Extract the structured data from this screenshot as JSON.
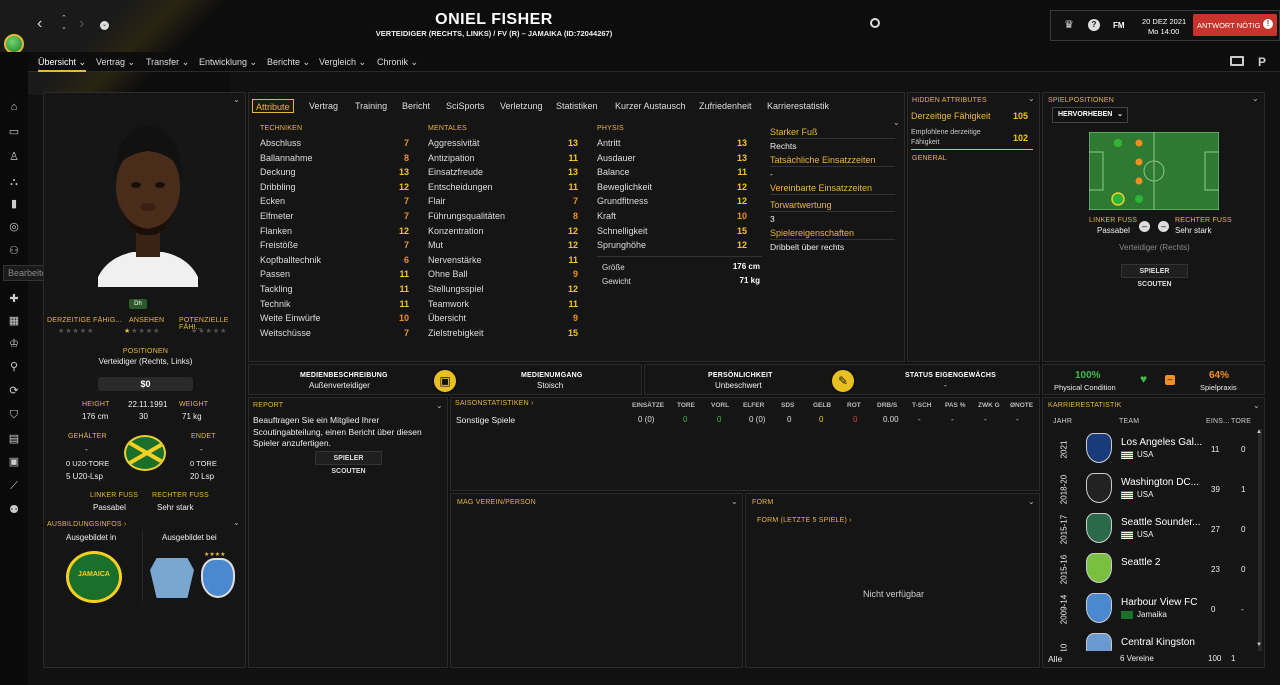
{
  "header": {
    "player_name": "ONIEL FISHER",
    "subtitle": "VERTEIDIGER (RECHTS, LINKS) / FV (R) – JAMAIKA (ID:72044267)",
    "date": "20 DEZ 2021",
    "time": "Mo 14:00",
    "fm": "FM",
    "answer_btn": "ANTWORT NÖTIG",
    "answer_icon": "exclamation-icon"
  },
  "nav": {
    "items": [
      "Übersicht",
      "Vertrag",
      "Transfer",
      "Entwicklung",
      "Berichte",
      "Vergleich",
      "Chronik"
    ]
  },
  "sidebar": {
    "tooltip": "Bearbeiten"
  },
  "profile": {
    "club_badge": "Dh",
    "labels": {
      "current": "DERZEITIGE FÄHIG...",
      "reputation": "ANSEHEN",
      "potential": "POTENZIELLE FÄHI..."
    },
    "positions_label": "POSITIONEN",
    "positions": "Verteidiger (Rechts, Links)",
    "value": "$0",
    "height_label": "HEIGHT",
    "dob": "22.11.1991",
    "weight_label": "WEIGHT",
    "height": "176 cm",
    "age": "30",
    "weight": "71 kg",
    "gehaelter_label": "GEHÄLTER",
    "gehaelter": "-",
    "endet_label": "ENDET",
    "endet": "-",
    "u20_label": "0 U20-TORE",
    "u20_lsp": "5 U20-Lsp",
    "tore": "0 TORE",
    "lsp": "20 Lsp",
    "left_foot_label": "LINKER FUSS",
    "left_foot": "Passabel",
    "right_foot_label": "RECHTER FUSS",
    "right_foot": "Sehr stark",
    "training_label": "AUSBILDUNGSINFOS",
    "trained_in": "Ausgebildet in",
    "trained_at": "Ausgebildet bei",
    "jamaica_text": "JAMAICA"
  },
  "tabs": [
    "Attribute",
    "Vertrag",
    "Training",
    "Bericht",
    "SciSports",
    "Verletzung",
    "Statistiken",
    "Kurzer Austausch",
    "Zufriedenheit",
    "Karrierestatistik"
  ],
  "attributes": {
    "tech_title": "TECHNIKEN",
    "technical": [
      [
        "Abschluss",
        "7"
      ],
      [
        "Ballannahme",
        "8"
      ],
      [
        "Deckung",
        "13"
      ],
      [
        "Dribbling",
        "12"
      ],
      [
        "Ecken",
        "7"
      ],
      [
        "Elfmeter",
        "7"
      ],
      [
        "Flanken",
        "12"
      ],
      [
        "Freistöße",
        "7"
      ],
      [
        "Kopfballtechnik",
        "6"
      ],
      [
        "Passen",
        "11"
      ],
      [
        "Tackling",
        "11"
      ],
      [
        "Technik",
        "11"
      ],
      [
        "Weite Einwürfe",
        "10"
      ],
      [
        "Weitschüsse",
        "7"
      ]
    ],
    "mental_title": "MENTALES",
    "mental": [
      [
        "Aggressivität",
        "13"
      ],
      [
        "Antizipation",
        "11"
      ],
      [
        "Einsatzfreude",
        "13"
      ],
      [
        "Entscheidungen",
        "11"
      ],
      [
        "Flair",
        "7"
      ],
      [
        "Führungsqualitäten",
        "8"
      ],
      [
        "Konzentration",
        "12"
      ],
      [
        "Mut",
        "12"
      ],
      [
        "Nervenstärke",
        "11"
      ],
      [
        "Ohne Ball",
        "9"
      ],
      [
        "Stellungsspiel",
        "12"
      ],
      [
        "Teamwork",
        "11"
      ],
      [
        "Übersicht",
        "9"
      ],
      [
        "Zielstrebigkeit",
        "15"
      ]
    ],
    "phys_title": "PHYSIS",
    "physical": [
      [
        "Antritt",
        "13"
      ],
      [
        "Ausdauer",
        "13"
      ],
      [
        "Balance",
        "11"
      ],
      [
        "Beweglichkeit",
        "12"
      ],
      [
        "Grundfitness",
        "12"
      ],
      [
        "Kraft",
        "10"
      ],
      [
        "Schnelligkeit",
        "15"
      ],
      [
        "Sprunghöhe",
        "12"
      ]
    ],
    "size": [
      [
        "Größe",
        "176 cm"
      ],
      [
        "Gewicht",
        "71 kg"
      ]
    ],
    "info": [
      [
        "Starker Fuß",
        "Rechts"
      ],
      [
        "Tatsächliche Einsatzzeiten",
        "-"
      ],
      [
        "Vereinbarte Einsatzzeiten",
        ""
      ],
      [
        "Torwartwertung",
        "3"
      ],
      [
        "Spielereigenschaften",
        "Dribbelt über rechts"
      ]
    ]
  },
  "hidden": {
    "title": "HIDDEN ATTRIBUTES",
    "current_label": "Derzeitige Fähigkeit",
    "current": "105",
    "recommended_label": "Empfohlene derzeitige Fähigkeit",
    "recommended": "102",
    "general": "GENERAL"
  },
  "positions_panel": {
    "title": "SPIELPOSITIONEN",
    "dropdown": "HERVORHEBEN",
    "left_foot_label": "LINKER FUSS",
    "left_foot": "Passabel",
    "right_foot_label": "RECHTER FUSS",
    "right_foot": "Sehr stark",
    "role": "Verteidiger (Rechts)",
    "scout_btn": "SPIELER SCOUTEN"
  },
  "media": {
    "desc_label": "MEDIENBESCHREIBUNG",
    "desc": "Außenverteidiger",
    "handling_label": "MEDIENUMGANG",
    "handling": "Stoisch",
    "personality_label": "PERSÖNLICHKEIT",
    "personality": "Unbeschwert",
    "homegrown_label": "STATUS EIGENGEWÄCHS",
    "homegrown": "-"
  },
  "condition": {
    "physical": "100%",
    "physical_label": "Physical Condition",
    "practice": "64%",
    "practice_label": "Spielpraxis"
  },
  "report": {
    "title": "REPORT",
    "text": "Beauftragen Sie ein Mitglied Ihrer Scoutingabteilung, einen Bericht über diesen Spieler anzufertigen.",
    "btn": "SPIELER SCOUTEN"
  },
  "season": {
    "title": "SAISONSTATISTIKEN",
    "headers": [
      "EINSÄTZE",
      "TORE",
      "VORL",
      "ELFER",
      "SDS",
      "GELB",
      "ROT",
      "DRB/S",
      "T-SCH",
      "PAS %",
      "ZWK G",
      "ØNOTE"
    ],
    "row_label": "Sonstige Spiele",
    "row": [
      "0 (0)",
      "0",
      "0",
      "0 (0)",
      "0",
      "0",
      "0",
      "0.00",
      "-",
      "-",
      "-",
      "-"
    ]
  },
  "fav_club": {
    "title": "MAG VEREIN/PERSON"
  },
  "form": {
    "title": "FORM",
    "subtitle": "FORM (LETZTE 5 SPIELE)",
    "empty": "Nicht verfügbar"
  },
  "career": {
    "title": "KARRIERESTATISTIK",
    "headers": [
      "JAHR",
      "TEAM",
      "EINS...",
      "TORE"
    ],
    "rows": [
      {
        "year": "2021",
        "team": "Los Angeles Gal...",
        "nation": "USA",
        "apps": "11",
        "goals": "0"
      },
      {
        "year": "2018-20",
        "team": "Washington DC...",
        "nation": "USA",
        "apps": "39",
        "goals": "1"
      },
      {
        "year": "2015-17",
        "team": "Seattle Sounder...",
        "nation": "USA",
        "apps": "27",
        "goals": "0"
      },
      {
        "year": "2015-16",
        "team": "Seattle 2",
        "nation": "",
        "apps": "23",
        "goals": "0"
      },
      {
        "year": "2009-14",
        "team": "Harbour View FC",
        "nation": "Jamaika",
        "apps": "0",
        "goals": "-"
      },
      {
        "year": "-10",
        "team": "Central Kingston",
        "nation": "",
        "apps": "",
        "goals": ""
      }
    ],
    "total_label": "Alle",
    "total_clubs": "6 Vereine",
    "total_apps": "100",
    "total_goals": "1"
  },
  "colors": {
    "accent": "#e8b73a",
    "good": "#f5c518",
    "bad": "#f09020",
    "pitch": "#2f7a32"
  }
}
